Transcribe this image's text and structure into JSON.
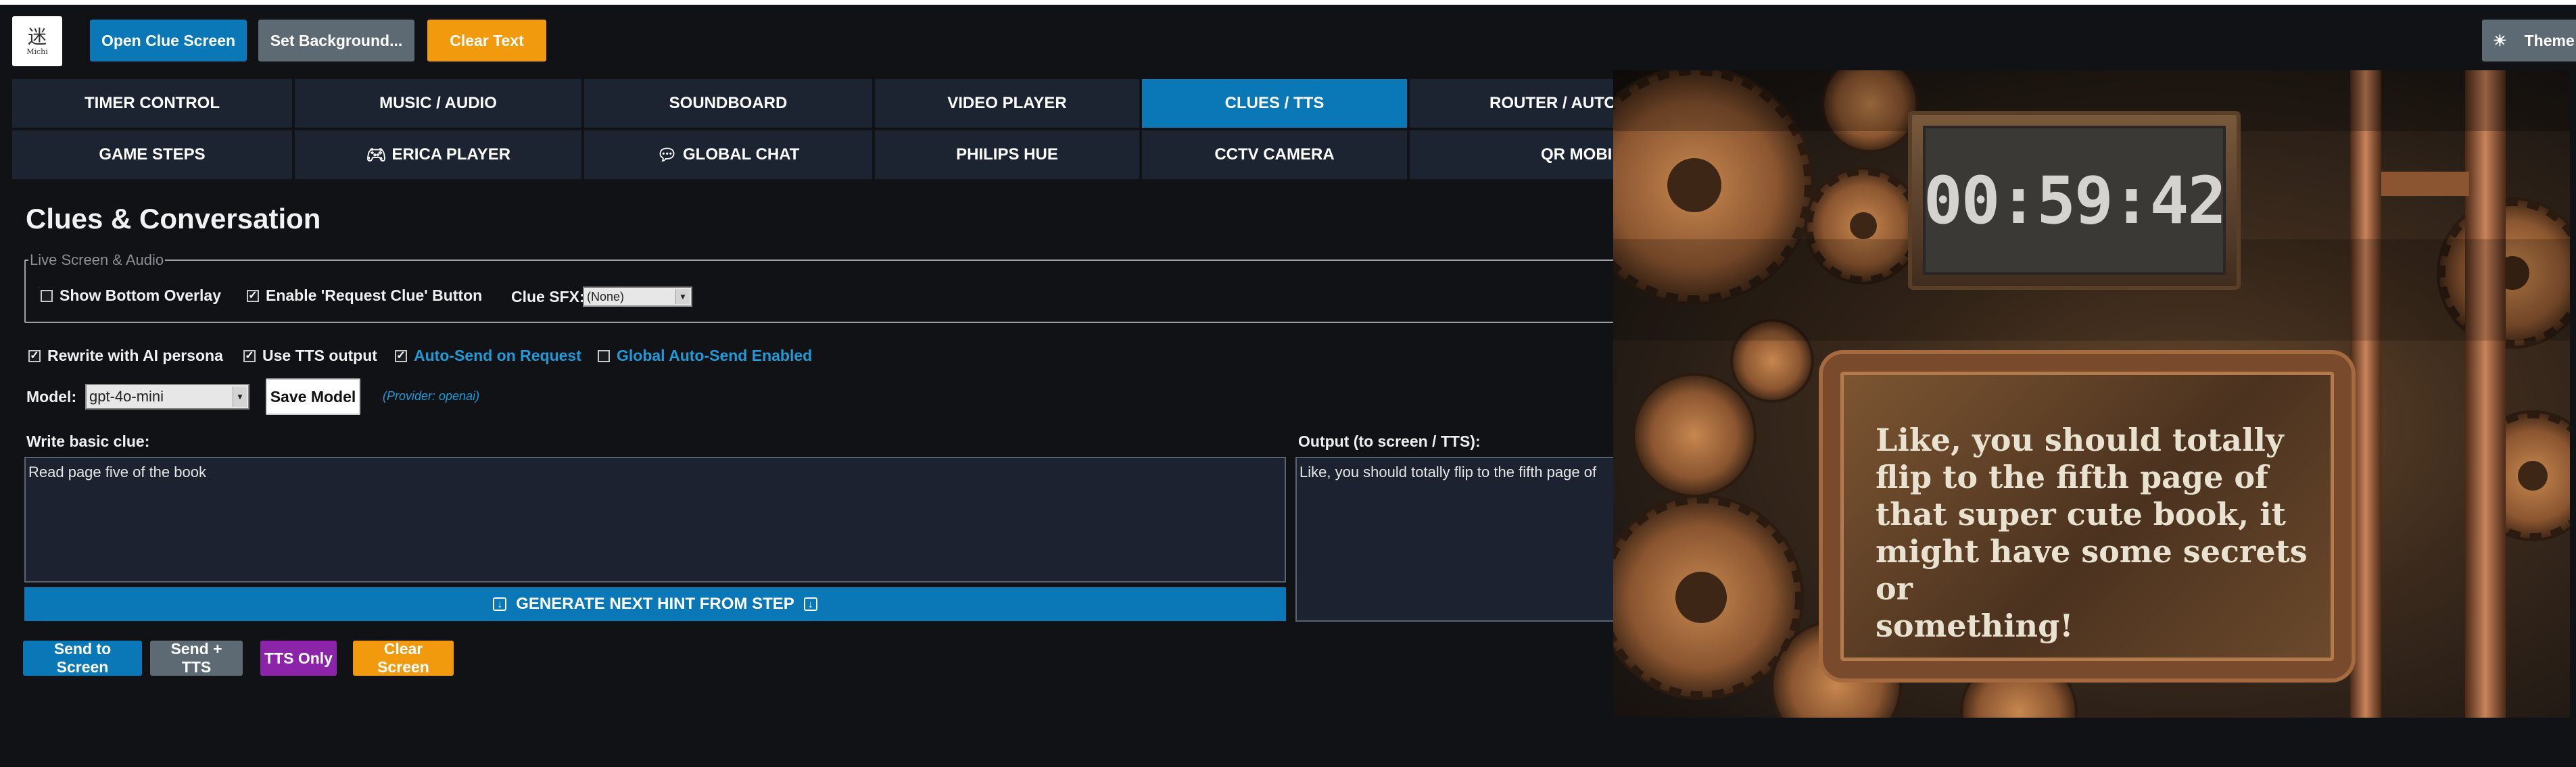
{
  "app": {
    "logo_text": "Michi",
    "logo_glyph": "迷"
  },
  "toolbar": {
    "open_clue_screen": "Open Clue Screen",
    "set_background": "Set Background...",
    "clear_text": "Clear Text",
    "theme": "Theme",
    "theme_icon": "sun-icon"
  },
  "tabs_row1": [
    {
      "label": "TIMER CONTROL"
    },
    {
      "label": "MUSIC / AUDIO"
    },
    {
      "label": "SOUNDBOARD"
    },
    {
      "label": "VIDEO PLAYER"
    },
    {
      "label": "CLUES / TTS",
      "active": true
    },
    {
      "label": "ROUTER / AUTOM"
    }
  ],
  "tabs_row2": [
    {
      "label": "GAME STEPS"
    },
    {
      "label": "ERICA PLAYER",
      "icon": "gamepad-icon"
    },
    {
      "label": "GLOBAL CHAT",
      "icon": "chat-bubble-icon"
    },
    {
      "label": "PHILIPS HUE"
    },
    {
      "label": "CCTV CAMERA"
    },
    {
      "label": "QR MOBIL"
    }
  ],
  "section": {
    "title": "Clues & Conversation",
    "live_legend": "Live Screen & Audio",
    "show_bottom_overlay": {
      "label": "Show Bottom Overlay",
      "checked": false
    },
    "enable_request_clue": {
      "label": "Enable 'Request Clue' Button",
      "checked": true
    },
    "clue_sfx_label": "Clue SFX:",
    "clue_sfx_value": "(None)"
  },
  "options": {
    "rewrite_ai": {
      "label": "Rewrite with AI persona",
      "checked": true
    },
    "use_tts": {
      "label": "Use TTS output",
      "checked": true
    },
    "auto_send": {
      "label": "Auto-Send on Request",
      "checked": true
    },
    "global_auto_send": {
      "label": "Global Auto-Send Enabled",
      "checked": false
    }
  },
  "model": {
    "label": "Model:",
    "value": "gpt-4o-mini",
    "save": "Save Model",
    "provider": "(Provider: openai)"
  },
  "input": {
    "label": "Write basic clue:",
    "value": "Read page five of the book"
  },
  "output": {
    "label": "Output (to screen / TTS):",
    "value": "Like, you should totally flip to the fifth page of"
  },
  "generate": {
    "label": "GENERATE NEXT HINT FROM STEP"
  },
  "actions": {
    "send_screen": "Send to Screen",
    "send_tts": "Send + TTS",
    "tts_only": "TTS Only",
    "clear_screen": "Clear Screen"
  },
  "preview": {
    "timer": "00:59:42",
    "clue_lines": [
      "Like, you should totally",
      "flip to the fifth page of",
      "that super cute book, it",
      "might have some secrets or",
      "something!"
    ]
  },
  "colors": {
    "accent_blue": "#0a77b7",
    "gray_button": "#5d6a74",
    "orange_button": "#f29a0e",
    "purple_button": "#8b24a8",
    "link_blue": "#1f9ad6"
  }
}
